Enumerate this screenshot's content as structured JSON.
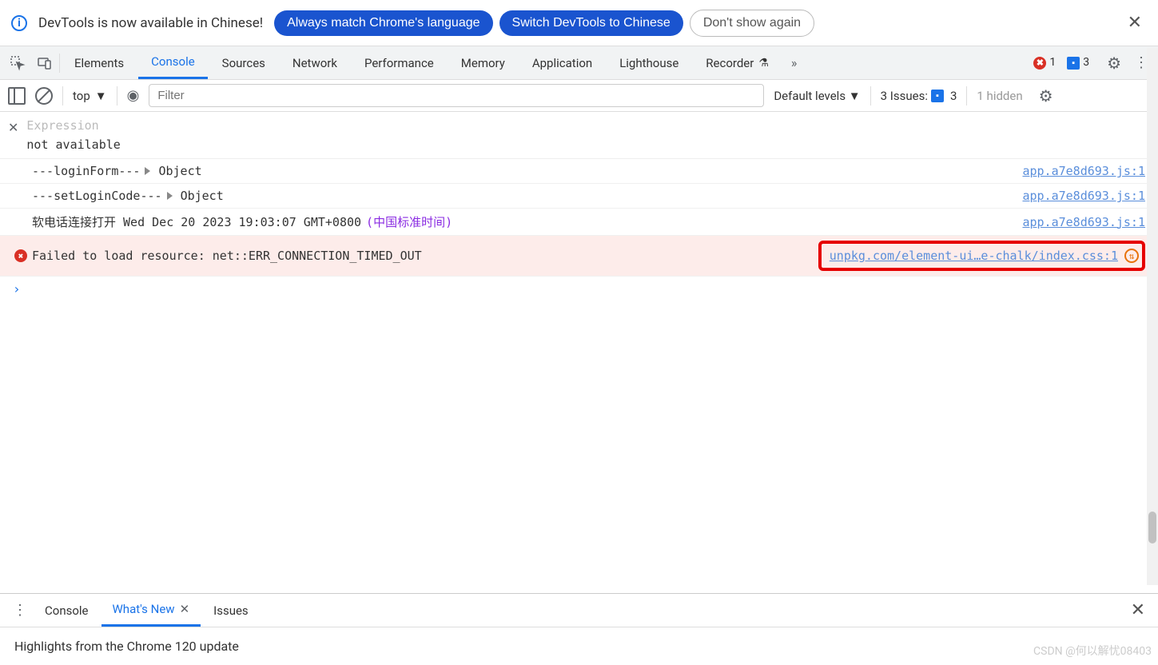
{
  "infobar": {
    "message": "DevTools is now available in Chinese!",
    "btn_match": "Always match Chrome's language",
    "btn_switch": "Switch DevTools to Chinese",
    "btn_dismiss": "Don't show again"
  },
  "tabs": {
    "elements": "Elements",
    "console": "Console",
    "sources": "Sources",
    "network": "Network",
    "performance": "Performance",
    "memory": "Memory",
    "application": "Application",
    "lighthouse": "Lighthouse",
    "recorder": "Recorder",
    "error_count": "1",
    "issue_count": "3"
  },
  "toolbar": {
    "context": "top",
    "filter_placeholder": "Filter",
    "levels": "Default levels",
    "issues_label": "3 Issues:",
    "issues_count": "3",
    "hidden": "1 hidden"
  },
  "live": {
    "expr_placeholder": "Expression",
    "result": "not available"
  },
  "logs": [
    {
      "msg_prefix": "---loginForm---",
      "obj": "Object",
      "src": "app.a7e8d693.js:1",
      "expand": true
    },
    {
      "msg_prefix": "---setLoginCode---",
      "obj": "Object",
      "src": "app.a7e8d693.js:1",
      "expand": true
    },
    {
      "msg_text": "软电话连接打开 Wed Dec 20 2023 19:03:07 GMT+0800 ",
      "msg_paren": "(中国标准时间)",
      "src": "app.a7e8d693.js:1"
    },
    {
      "error": true,
      "msg_text": "Failed to load resource: net::ERR_CONNECTION_TIMED_OUT",
      "src": "unpkg.com/element-ui…e-chalk/index.css:1"
    }
  ],
  "drawer": {
    "tab_console": "Console",
    "tab_whatsnew": "What's New",
    "tab_issues": "Issues",
    "headline": "Highlights from the Chrome 120 update"
  },
  "watermark": "CSDN @何以解忧08403"
}
